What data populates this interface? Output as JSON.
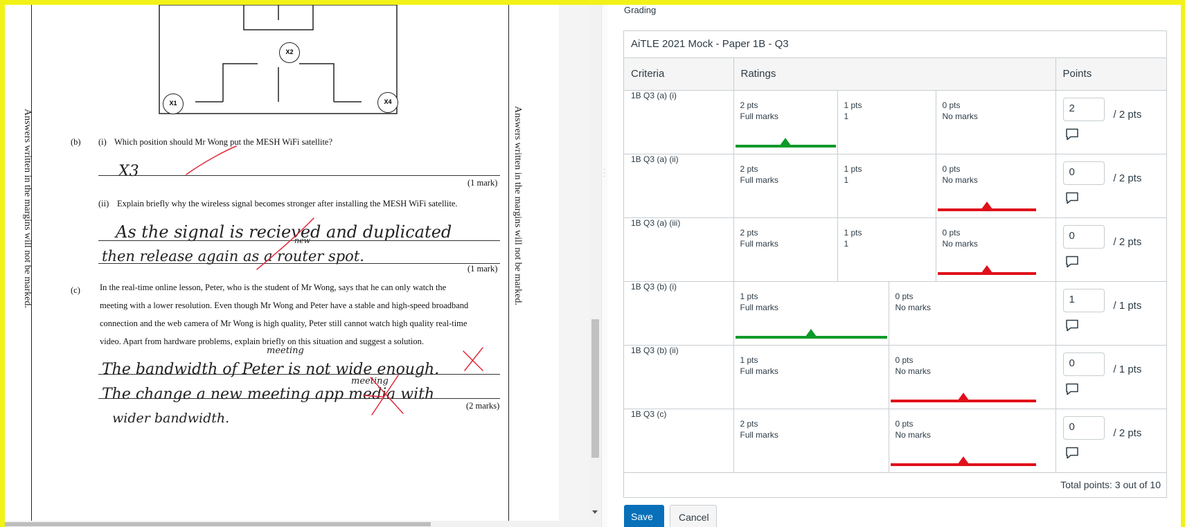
{
  "document": {
    "margin_text": "Answers written in the margins will not be marked.",
    "diagram": {
      "labels": [
        "X2",
        "X1",
        "X4"
      ]
    },
    "q_b_label": "(b)",
    "q_b_i_label": "(i)",
    "q_b_i_text": "Which position should Mr Wong put the MESH WiFi satellite?",
    "q_b_i_answer": "X3",
    "q_b_i_marks": "(1 mark)",
    "q_b_ii_label": "(ii)",
    "q_b_ii_text": "Explain briefly why the wireless signal becomes stronger after installing the MESH WiFi satellite.",
    "q_b_ii_answer_1": "As the signal is recieved and duplicated",
    "q_b_ii_answer_2": "then release again as a router spot.",
    "q_b_ii_insert": "new",
    "q_b_ii_marks": "(1 mark)",
    "q_c_label": "(c)",
    "q_c_text_1": "In the real-time online lesson, Peter, who is the student of Mr Wong, says that he can only watch the",
    "q_c_text_2": "meeting with a lower resolution. Even though Mr Wong and Peter have a stable and high-speed broadband",
    "q_c_text_3": "connection and the web camera of Mr Wong is high quality, Peter still cannot watch high quality real-time",
    "q_c_text_4": "video. Apart from hardware problems, explain briefly on this situation and suggest a solution.",
    "q_c_answer_1": "The bandwidth of Peter is not wide enough.",
    "q_c_answer_1_insert": "meeting",
    "q_c_answer_2": "The change a new meeting app media with",
    "q_c_answer_2_insert": "meeting",
    "q_c_answer_3": "wider bandwidth.",
    "q_c_marks": "(2 marks)"
  },
  "grading": {
    "section_label": "Grading",
    "rubric_title": "AiTLE 2021 Mock - Paper 1B - Q3",
    "headers": {
      "criteria": "Criteria",
      "ratings": "Ratings",
      "points": "Points"
    },
    "rows": [
      {
        "criterion": "1B Q3 (a) (i)",
        "ratings": [
          {
            "points": "2 pts",
            "desc": "Full marks",
            "selected": true,
            "color": "#0b9a2a"
          },
          {
            "points": "1 pts",
            "desc": "1",
            "selected": false
          },
          {
            "points": "0 pts",
            "desc": "No marks",
            "selected": false
          }
        ],
        "score": "2",
        "max": "/ 2 pts"
      },
      {
        "criterion": "1B Q3 (a) (ii)",
        "ratings": [
          {
            "points": "2 pts",
            "desc": "Full marks",
            "selected": false
          },
          {
            "points": "1 pts",
            "desc": "1",
            "selected": false
          },
          {
            "points": "0 pts",
            "desc": "No marks",
            "selected": true,
            "color": "#e0101a"
          }
        ],
        "score": "0",
        "max": "/ 2 pts"
      },
      {
        "criterion": "1B Q3 (a) (iii)",
        "ratings": [
          {
            "points": "2 pts",
            "desc": "Full marks",
            "selected": false
          },
          {
            "points": "1 pts",
            "desc": "1",
            "selected": false
          },
          {
            "points": "0 pts",
            "desc": "No marks",
            "selected": true,
            "color": "#e0101a"
          }
        ],
        "score": "0",
        "max": "/ 2 pts"
      },
      {
        "criterion": "1B Q3 (b) (i)",
        "ratings": [
          {
            "points": "1 pts",
            "desc": "Full marks",
            "selected": true,
            "color": "#0b9a2a"
          },
          {
            "points": "0 pts",
            "desc": "No marks",
            "selected": false
          }
        ],
        "score": "1",
        "max": "/ 1 pts"
      },
      {
        "criterion": "1B Q3 (b) (ii)",
        "ratings": [
          {
            "points": "1 pts",
            "desc": "Full marks",
            "selected": false
          },
          {
            "points": "0 pts",
            "desc": "No marks",
            "selected": true,
            "color": "#e0101a"
          }
        ],
        "score": "0",
        "max": "/ 1 pts"
      },
      {
        "criterion": "1B Q3 (c)",
        "ratings": [
          {
            "points": "2 pts",
            "desc": "Full marks",
            "selected": false
          },
          {
            "points": "0 pts",
            "desc": "No marks",
            "selected": true,
            "color": "#e0101a"
          }
        ],
        "score": "0",
        "max": "/ 2 pts"
      }
    ],
    "total": "Total points: 3 out of 10",
    "save_label": "Save",
    "cancel_label": "Cancel"
  }
}
